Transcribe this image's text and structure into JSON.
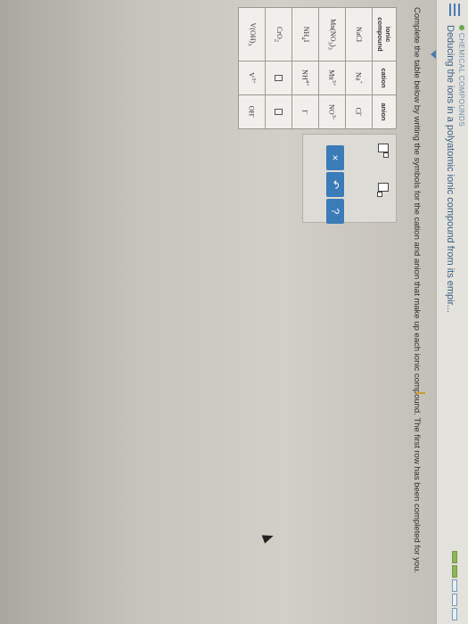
{
  "header": {
    "eyebrow": "CHEMICAL COMPOUNDS",
    "topic_title": "Deducing the ions in a polyatomic ionic compound from its empir...",
    "progress": [
      1,
      1,
      0,
      0,
      0
    ]
  },
  "instructions": "Complete the table below by writing the symbols for the cation and anion that make up each ionic compound. The first row has been completed for you.",
  "table": {
    "headers": [
      "ionic compound",
      "cation",
      "anion"
    ],
    "rows": [
      {
        "compound": "NaCl",
        "cation": "Na+",
        "anion": "Cl-"
      },
      {
        "compound": "Mn(NO3)3",
        "cation": "Mn3+",
        "anion": "NO3-"
      },
      {
        "compound": "NH4I",
        "cation": "NH4+",
        "anion": "I-"
      },
      {
        "compound": "CrO2",
        "cation": "",
        "anion": ""
      },
      {
        "compound": "V(OH)3",
        "cation": "V3+",
        "anion": "OH-"
      }
    ]
  },
  "tools": {
    "clear_label": "×",
    "undo_label": "↶",
    "help_label": "?"
  }
}
